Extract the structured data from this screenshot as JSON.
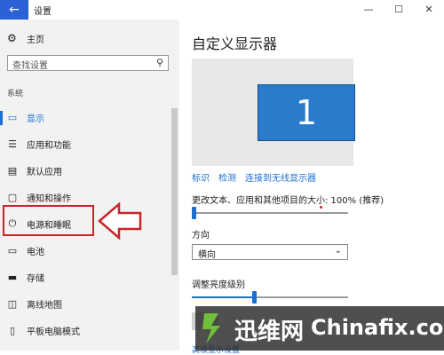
{
  "window": {
    "title": "设置",
    "back_icon": "←",
    "minimize": "—",
    "maximize": "☐",
    "close": "✕"
  },
  "sidebar": {
    "home_label": "主页",
    "search_placeholder": "查找设置",
    "section_label": "系统",
    "items": [
      {
        "label": "显示",
        "icon": "display-icon",
        "active": true
      },
      {
        "label": "应用和功能",
        "icon": "apps-list-icon"
      },
      {
        "label": "默认应用",
        "icon": "default-apps-icon"
      },
      {
        "label": "通知和操作",
        "icon": "notifications-icon"
      },
      {
        "label": "电源和睡眠",
        "icon": "power-icon",
        "highlighted": true
      },
      {
        "label": "电池",
        "icon": "battery-icon"
      },
      {
        "label": "存储",
        "icon": "storage-icon"
      },
      {
        "label": "离线地图",
        "icon": "offline-maps-icon"
      },
      {
        "label": "平板电脑模式",
        "icon": "tablet-mode-icon"
      }
    ]
  },
  "main": {
    "title": "自定义显示器",
    "monitor_number": "1",
    "links": [
      "标识",
      "检测",
      "连接到无线显示器"
    ],
    "scale_label": "更改文本、应用和其他项目的大小: 100% (推荐)",
    "scale_slider_fraction": 0.0,
    "orientation_label": "方向",
    "orientation_value": "横向",
    "brightness_label": "调整亮度级别",
    "brightness_slider_fraction": 0.4,
    "advanced_link": "高级显示设置"
  },
  "watermark": {
    "chinese": "迅维网",
    "english": "Chinafix.com"
  },
  "colors": {
    "accent": "#1a6fd1",
    "titlebar_back": "#2b62d6",
    "monitor_fill": "#2a7bcb",
    "highlight_red": "#c8252b"
  }
}
